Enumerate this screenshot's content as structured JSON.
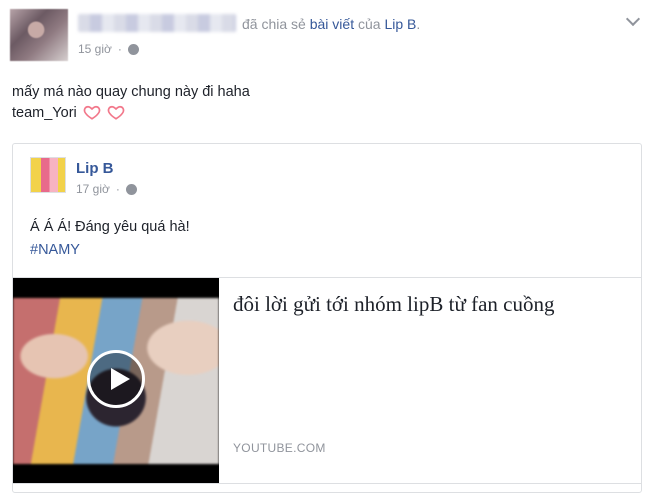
{
  "header": {
    "share_prefix": "đã chia sẻ ",
    "share_object": "bài viết",
    "share_middle": " của ",
    "share_page": "Lip B",
    "share_suffix": ".",
    "time": "15 giờ",
    "globe_icon": "globe-icon"
  },
  "post": {
    "line1": "mấy má nào quay chung này đi haha",
    "line2": "team_Yori",
    "heart_color": "#f2788b"
  },
  "shared": {
    "page_name": "Lip B",
    "time": "17 giờ",
    "text": "Á Á Á! Đáng yêu quá hà!",
    "hashtag": "#NAMY"
  },
  "link": {
    "title": "đôi lời gửi tới nhóm lipB từ fan cuồng",
    "domain": "YOUTUBE.COM"
  }
}
